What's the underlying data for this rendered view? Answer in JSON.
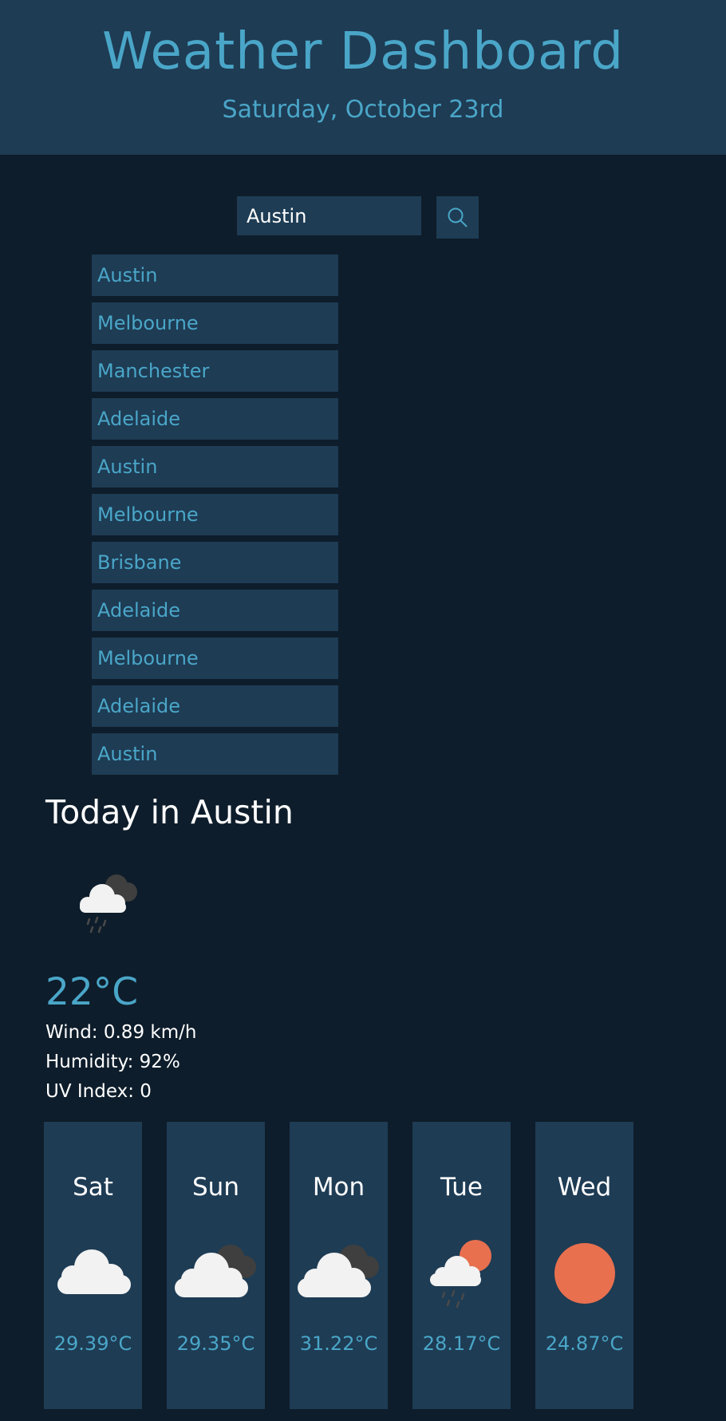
{
  "header": {
    "title": "Weather Dashboard",
    "date": "Saturday, October 23rd"
  },
  "search": {
    "value": "Austin",
    "button_icon": "search-icon"
  },
  "history": [
    "Austin",
    "Melbourne",
    "Manchester",
    "Adelaide",
    "Austin",
    "Melbourne",
    "Brisbane",
    "Adelaide",
    "Melbourne",
    "Adelaide",
    "Austin"
  ],
  "today": {
    "title": "Today in Austin",
    "icon": "cloud-rain-icon",
    "temp": "22°C",
    "wind": "Wind: 0.89 km/h",
    "humidity": "Humidity: 92%",
    "uv": "UV Index: 0"
  },
  "forecast": [
    {
      "day": "Sat",
      "icon": "cloud-icon",
      "temp": "29.39°C"
    },
    {
      "day": "Sun",
      "icon": "clouds-icon",
      "temp": "29.35°C"
    },
    {
      "day": "Mon",
      "icon": "clouds-icon",
      "temp": "31.22°C"
    },
    {
      "day": "Tue",
      "icon": "sun-rain-cloud-icon",
      "temp": "28.17°C"
    },
    {
      "day": "Wed",
      "icon": "sun-icon",
      "temp": "24.87°C"
    }
  ],
  "colors": {
    "background": "#0e1d2b",
    "panel": "#1e3c54",
    "accent": "#4aa6c8",
    "sun": "#e8704f"
  }
}
